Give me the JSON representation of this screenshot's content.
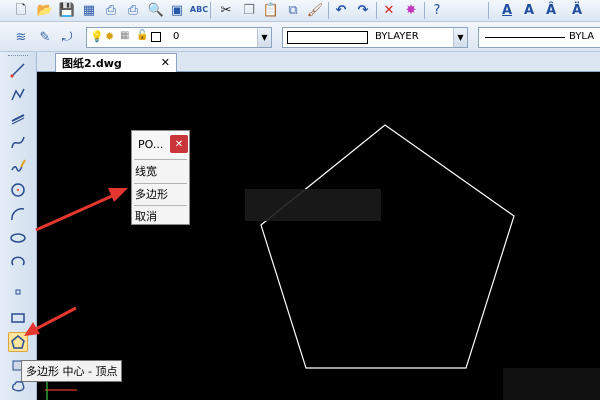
{
  "toolbar": {
    "icons": [
      "new-file-icon",
      "open-folder-icon",
      "save-icon",
      "save-as-icon",
      "print-icon",
      "plot-icon",
      "print-preview-icon",
      "publish-icon",
      "spell-check-icon",
      "cut-icon",
      "copy-icon",
      "paste-icon",
      "match-properties-icon",
      "brush-icon",
      "undo-icon",
      "redo-icon",
      "delete-icon",
      "explode-icon",
      "help-icon",
      "text-style-icon",
      "text-icon",
      "text-edit-icon",
      "text-find-icon"
    ]
  },
  "properties": {
    "layer_value": "0",
    "color_value": "BYLAYER",
    "linetype_value": "BYLA"
  },
  "tab": {
    "label": "图纸2.dwg",
    "close": "✕"
  },
  "popup": {
    "title": "PO...",
    "close": "✕",
    "items": [
      "线宽",
      "多边形",
      "取消"
    ]
  },
  "tooltip": {
    "text": "多边形  中心 - 顶点"
  },
  "colors": {
    "canvas": "#000000",
    "drawing_line": "#ffffff",
    "arrow": "#e5362f",
    "close_button": "#c9363a",
    "toolbar": "#dbe6f3"
  }
}
